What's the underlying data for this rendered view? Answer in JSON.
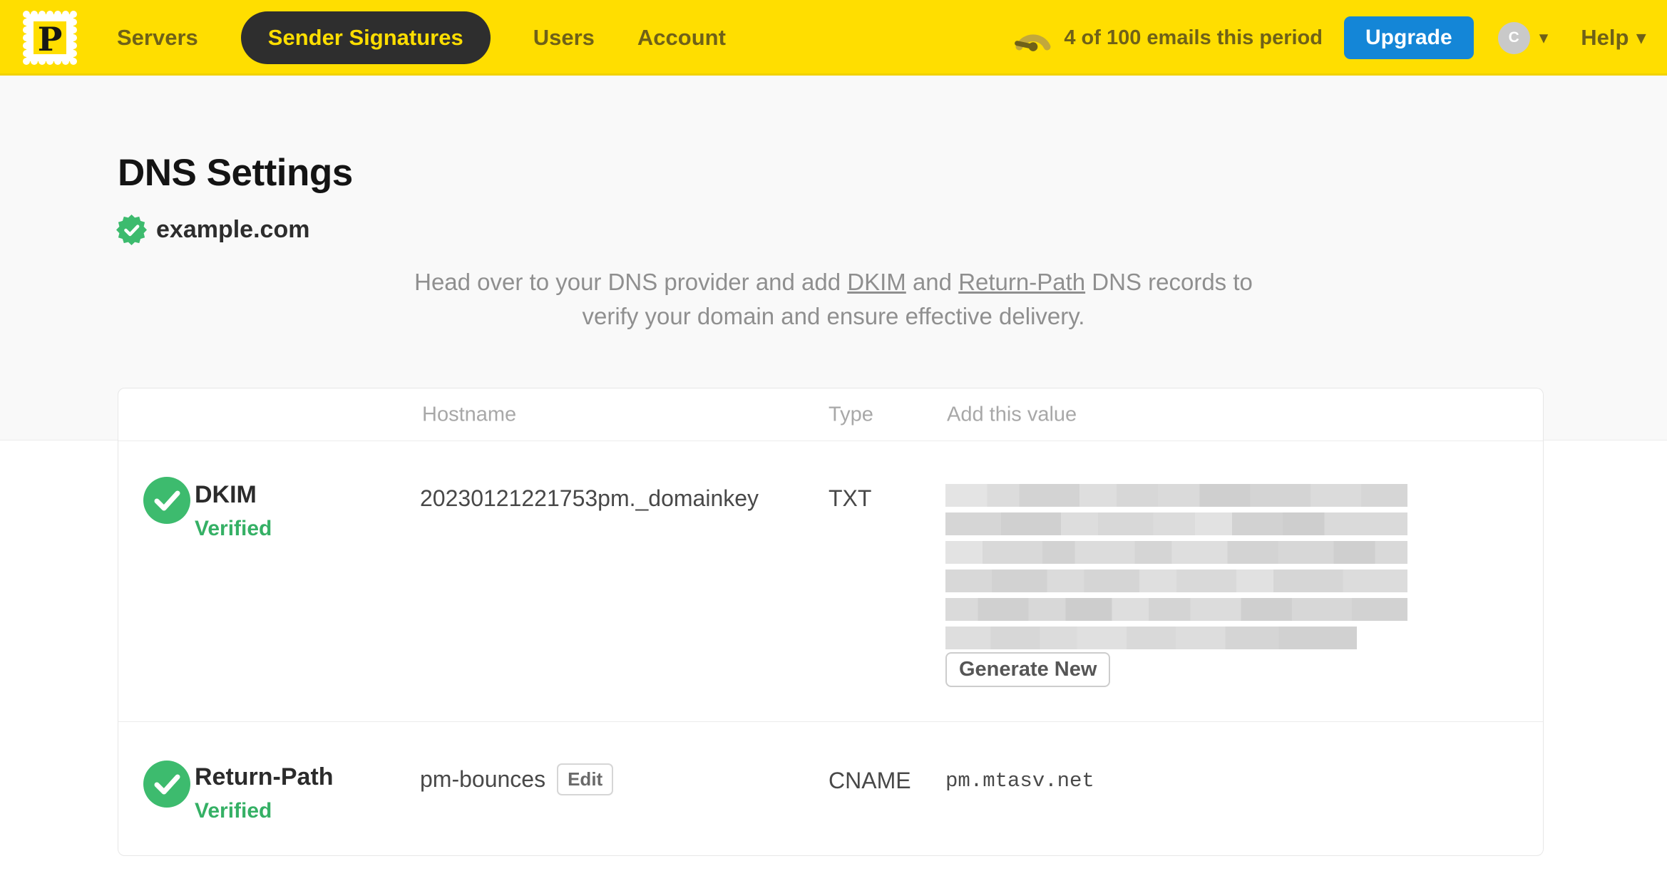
{
  "nav": {
    "logo_letter": "P",
    "items": [
      {
        "label": "Servers",
        "active": false
      },
      {
        "label": "Sender Signatures",
        "active": true
      },
      {
        "label": "Users",
        "active": false
      },
      {
        "label": "Account",
        "active": false
      }
    ],
    "usage": {
      "icon": "gauge-icon",
      "text": "4 of 100 emails this period"
    },
    "upgrade_label": "Upgrade",
    "avatar_initial": "C",
    "caret_glyph": "▾",
    "help_label": "Help"
  },
  "page": {
    "title": "DNS Settings",
    "domain": "example.com",
    "domain_badge_icon": "verified-seal-icon",
    "description": {
      "line1_pre": "Head over to your DNS provider and add ",
      "dkim_link": "DKIM",
      "line1_mid": " and ",
      "returnpath_link": "Return-Path",
      "line1_post": " DNS records to",
      "line2": "verify your domain and ensure effective delivery."
    }
  },
  "table": {
    "headers": [
      "Hostname",
      "Type",
      "Add this value"
    ],
    "rows": [
      {
        "name": "DKIM",
        "status": "Verified",
        "status_icon": "check-circle-icon",
        "hostname": "20230121221753pm._domainkey",
        "type": "TXT",
        "value_redacted": true,
        "redacted_lines": 6,
        "action_label": "Generate New"
      },
      {
        "name": "Return-Path",
        "status": "Verified",
        "status_icon": "check-circle-icon",
        "hostname": "pm-bounces",
        "edit_label": "Edit",
        "type": "CNAME",
        "value": "pm.mtasv.net"
      }
    ]
  },
  "colors": {
    "brand_yellow": "#ffde00",
    "nav_text_olive": "#6f6118",
    "active_pill_bg": "#2e2e2e",
    "upgrade_blue": "#1486d7",
    "verified_green": "#3dbb6e",
    "verified_text_green": "#35b065",
    "muted_text": "#8f8f8f",
    "page_bg": "#f9f9f9"
  }
}
